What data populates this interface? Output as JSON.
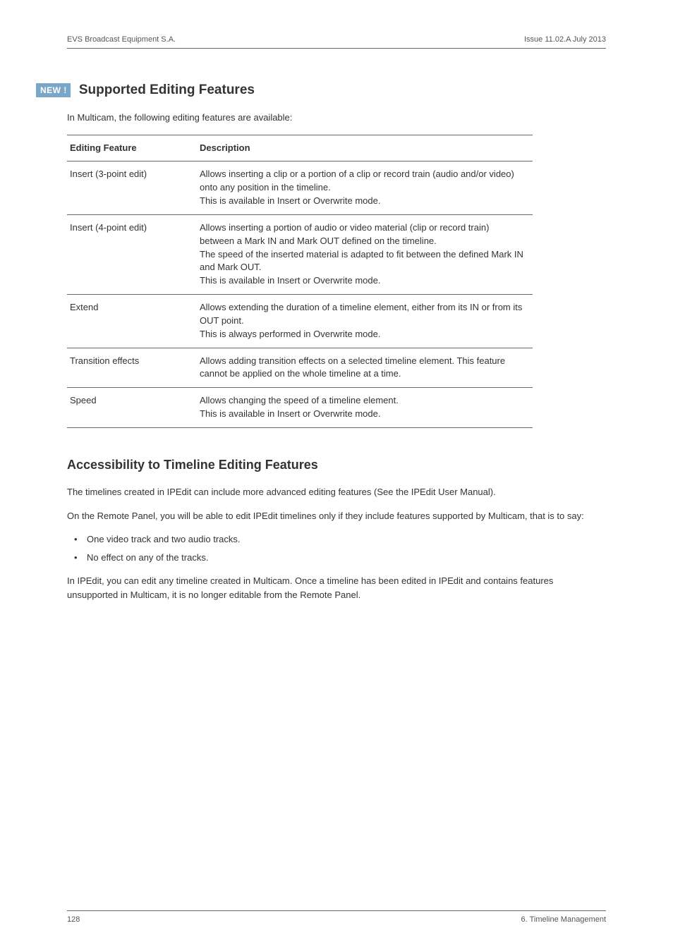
{
  "header": {
    "left": "EVS Broadcast Equipment S.A.",
    "right": "Issue 11.02.A   July 2013"
  },
  "section1": {
    "badge": "NEW !",
    "title": "Supported Editing Features",
    "intro": "In Multicam, the following editing features are available:",
    "table": {
      "head": {
        "c1": "Editing Feature",
        "c2": "Description"
      },
      "rows": [
        {
          "feature": "Insert (3-point edit)",
          "desc": "Allows inserting a clip or a portion of a clip or record train (audio and/or video) onto any position in the timeline.\nThis is available in Insert or Overwrite mode."
        },
        {
          "feature": "Insert (4-point edit)",
          "desc": "Allows inserting a portion of audio or video material (clip or record train) between a Mark IN and Mark OUT defined on the timeline.\nThe speed of the inserted material is adapted to fit between the defined Mark IN and Mark OUT.\nThis is available in Insert or Overwrite mode."
        },
        {
          "feature": "Extend",
          "desc": "Allows extending the duration of a timeline element, either from its IN or from its OUT point.\nThis is always performed in Overwrite mode."
        },
        {
          "feature": "Transition effects",
          "desc": "Allows adding transition effects on a selected timeline element. This feature cannot be applied on the whole timeline at a time."
        },
        {
          "feature": "Speed",
          "desc": "Allows changing the speed of a timeline element.\nThis is available in Insert or Overwrite mode."
        }
      ]
    }
  },
  "section2": {
    "title": "Accessibility to Timeline Editing Features",
    "paras": [
      "The timelines created in IPEdit can include more advanced editing features (See the IPEdit User Manual).",
      "On the Remote Panel, you will be able to edit IPEdit timelines only if they include features supported by Multicam, that is to say:"
    ],
    "bullets": [
      "One video track and two audio tracks.",
      "No effect on any of the tracks."
    ],
    "after": "In IPEdit, you can edit any timeline created in Multicam. Once a timeline has been edited in IPEdit and contains features unsupported in Multicam, it is no longer editable from the Remote Panel."
  },
  "footer": {
    "left": "128",
    "right": "6. Timeline Management"
  }
}
